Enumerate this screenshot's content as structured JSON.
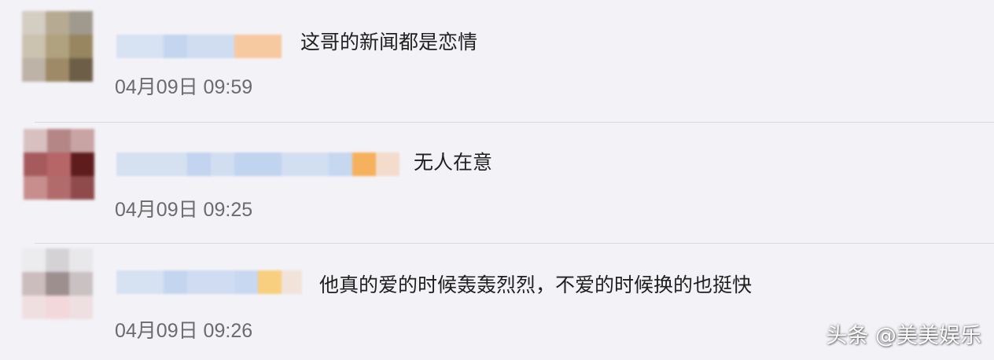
{
  "comments": [
    {
      "text": "这哥的新闻都是恋情",
      "timestamp": "04月09日 09:59",
      "avatar_colors": [
        "#d4cdc2",
        "#b7aa93",
        "#a09a8e",
        "#cbc2af",
        "#b0a27e",
        "#978660",
        "#bdb3a7",
        "#9e8a67",
        "#6d5e47"
      ],
      "name_colors": [
        "#d7e2f2",
        "#c4d5ef",
        "#d0ddf1",
        "#f6c9a0"
      ]
    },
    {
      "text": "无人在意",
      "timestamp": "04月09日 09:25",
      "avatar_colors": [
        "#d8c0c0",
        "#b58686",
        "#c9a4a4",
        "#a65a5c",
        "#b66667",
        "#5e1c1c",
        "#c88e8e",
        "#b16b6b",
        "#8f4b4b"
      ],
      "name_colors": [
        "#d5e0f1",
        "#c2d4ef",
        "#d1def2",
        "#c0d3ef",
        "#d2def2",
        "#c6d7f0",
        "#f6b15c",
        "#f4dccd"
      ]
    },
    {
      "text": "他真的爱的时候轰轰烈烈，不爱的时候换的也挺快",
      "timestamp": "04月09日 09:26",
      "avatar_colors": [
        "#ececef",
        "#d5d2d6",
        "#e8e7ea",
        "#cbbdbd",
        "#9e8f8f",
        "#c9c1c2",
        "#f0dfe1",
        "#f3d8db",
        "#eedfe1"
      ],
      "name_colors": [
        "#d6e1f2",
        "#c4d6ef",
        "#d0dcf1",
        "#c8d8f0",
        "#f7cf7f",
        "#f1e3da"
      ]
    }
  ],
  "watermark": "头条 @美美娱乐"
}
